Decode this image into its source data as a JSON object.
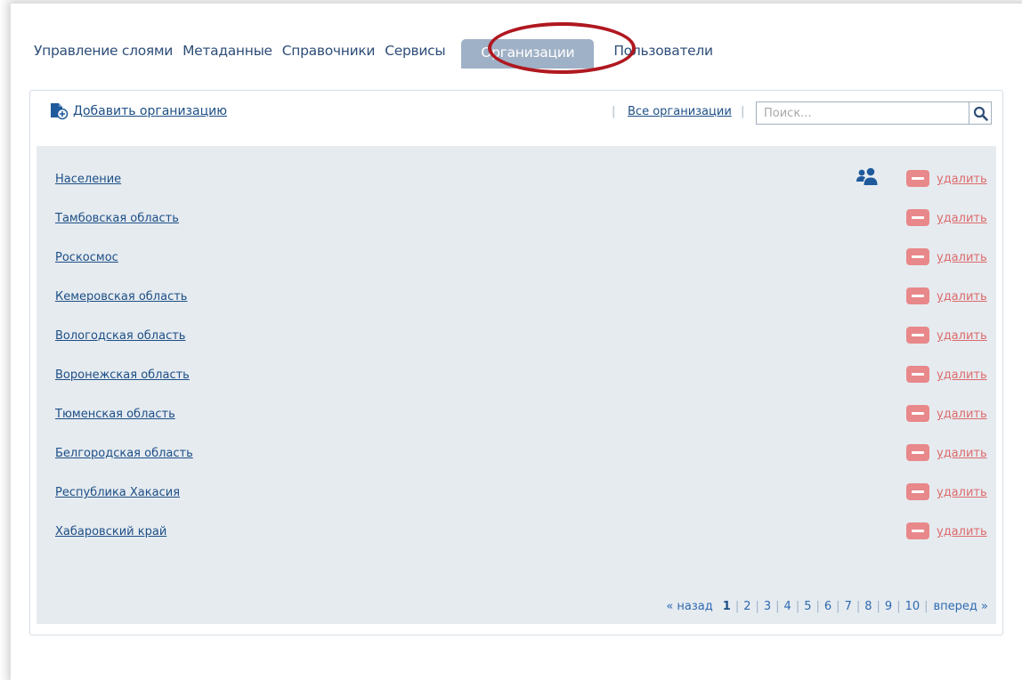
{
  "nav": {
    "items": [
      {
        "label": "Управление слоями"
      },
      {
        "label": "Метаданные"
      },
      {
        "label": "Справочники"
      },
      {
        "label": "Сервисы"
      },
      {
        "label": "Организации"
      },
      {
        "label": "Пользователи"
      }
    ],
    "active_index": 4
  },
  "toolbar": {
    "add_label": "Добавить организацию",
    "separator": "|",
    "all_label": "Все организации",
    "search_placeholder": "Поиск...",
    "search_value": ""
  },
  "organizations": [
    {
      "name": "Население",
      "delete_label": "удалить",
      "has_users_icon": true
    },
    {
      "name": "Тамбовская область",
      "delete_label": "удалить"
    },
    {
      "name": "Роскосмос",
      "delete_label": "удалить"
    },
    {
      "name": "Кемеровская область",
      "delete_label": "удалить"
    },
    {
      "name": "Вологодская область",
      "delete_label": "удалить"
    },
    {
      "name": "Воронежская область",
      "delete_label": "удалить"
    },
    {
      "name": "Тюменская область",
      "delete_label": "удалить"
    },
    {
      "name": "Белгородская область",
      "delete_label": "удалить"
    },
    {
      "name": "Республика Хакасия",
      "delete_label": "удалить"
    },
    {
      "name": "Хабаровский край",
      "delete_label": "удалить"
    }
  ],
  "pager": {
    "prev_label": "« назад",
    "pages": [
      "1",
      "2",
      "3",
      "4",
      "5",
      "6",
      "7",
      "8",
      "9",
      "10"
    ],
    "current": "1",
    "next_label": "вперед »"
  },
  "icons": {
    "add": "add-organization-icon",
    "search": "search-icon",
    "users": "users-icon",
    "delete": "delete-icon"
  },
  "colors": {
    "link": "#1d4f86",
    "active_tab": "#9fb1c6",
    "delete": "#e8888a",
    "highlight_ring": "#b01820",
    "list_background": "#e6ebf0"
  }
}
